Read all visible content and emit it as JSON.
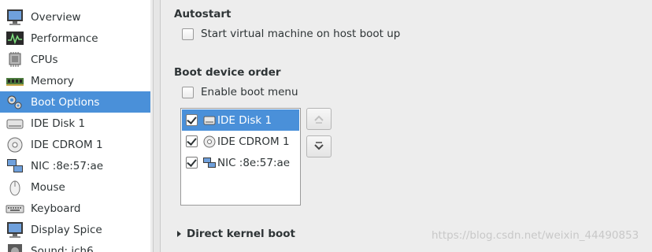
{
  "sidebar": {
    "items": [
      {
        "label": "Overview",
        "icon": "monitor-icon"
      },
      {
        "label": "Performance",
        "icon": "performance-graph-icon"
      },
      {
        "label": "CPUs",
        "icon": "cpu-chip-icon"
      },
      {
        "label": "Memory",
        "icon": "memory-module-icon"
      },
      {
        "label": "Boot Options",
        "icon": "boot-gears-icon",
        "selected": true
      },
      {
        "label": "IDE Disk 1",
        "icon": "hard-disk-icon"
      },
      {
        "label": "IDE CDROM 1",
        "icon": "cdrom-icon"
      },
      {
        "label": "NIC :8e:57:ae",
        "icon": "network-icon"
      },
      {
        "label": "Mouse",
        "icon": "mouse-icon"
      },
      {
        "label": "Keyboard",
        "icon": "keyboard-icon"
      },
      {
        "label": "Display Spice",
        "icon": "display-icon"
      },
      {
        "label": "Sound: ich6",
        "icon": "sound-icon"
      }
    ]
  },
  "autostart": {
    "title": "Autostart",
    "checkbox_label": "Start virtual machine on host boot up",
    "checked": false
  },
  "boot_order": {
    "title": "Boot device order",
    "enable_menu_label": "Enable boot menu",
    "enable_menu_checked": false,
    "devices": [
      {
        "label": "IDE Disk 1",
        "checked": true,
        "selected": true,
        "icon": "hard-disk-icon"
      },
      {
        "label": "IDE CDROM 1",
        "checked": true,
        "selected": false,
        "icon": "cdrom-icon"
      },
      {
        "label": "NIC :8e:57:ae",
        "checked": true,
        "selected": false,
        "icon": "network-icon"
      }
    ],
    "move_up_icon": "arrow-up-icon",
    "move_down_icon": "arrow-down-icon"
  },
  "direct_kernel_boot": {
    "label": "Direct kernel boot",
    "expanded": false
  },
  "watermark": "https://blog.csdn.net/weixin_44490853",
  "colors": {
    "selection": "#4a90d9",
    "background": "#ededed"
  }
}
